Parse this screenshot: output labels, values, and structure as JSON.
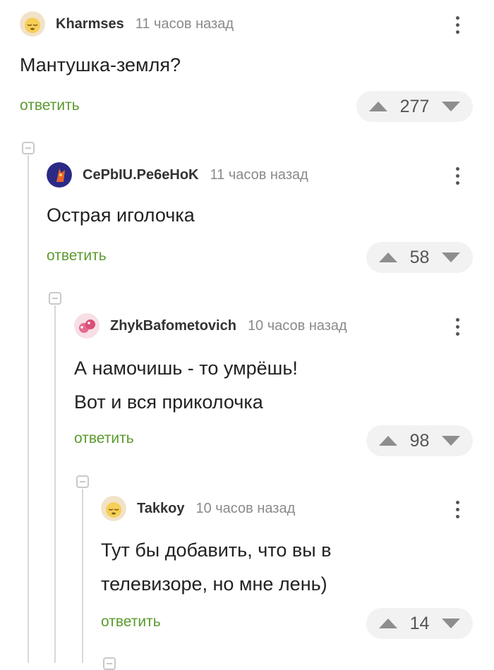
{
  "comments": [
    {
      "username": "Kharmses",
      "time": "11 часов назад",
      "text": [
        "Мантушка-земля?"
      ],
      "reply": "ответить",
      "rating": "277",
      "avatar_icon": "sleepy-face-avatar"
    },
    {
      "username": "CePbIU.Pe6eHoK",
      "time": "11 часов назад",
      "text": [
        "Острая иголочка"
      ],
      "reply": "ответить",
      "rating": "58",
      "avatar_icon": "dark-blue-orange-creature-avatar"
    },
    {
      "username": "ZhykBafometovich",
      "time": "10 часов назад",
      "text": [
        "А намочишь - то умрёшь!",
        "Вот и вся приколочка"
      ],
      "reply": "ответить",
      "rating": "98",
      "avatar_icon": "pink-cartoon-avatar"
    },
    {
      "username": "Takkoy",
      "time": "10 часов назад",
      "text": [
        "Тут бы добавить, что вы в",
        "телевизоре, но мне лень)"
      ],
      "reply": "ответить",
      "rating": "14",
      "avatar_icon": "sleepy-face-avatar"
    }
  ],
  "colors": {
    "reply_link": "#5b9a2e",
    "thread_line": "#d8d8d8",
    "vote_background": "#f2f2f2"
  }
}
